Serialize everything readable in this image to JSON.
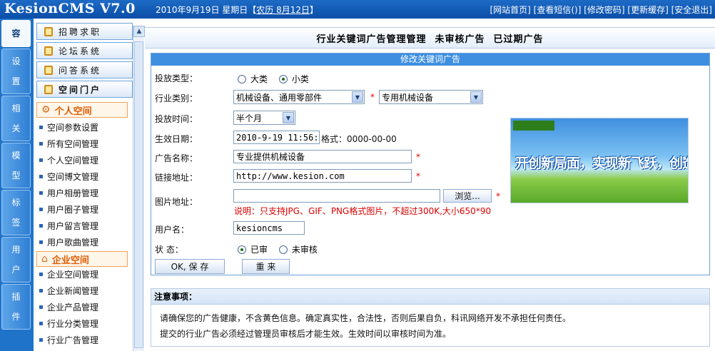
{
  "app": {
    "logo": "KesionCMS V7.0"
  },
  "header": {
    "date": "2010年9月19日 星期日【",
    "lunar": "农历 8月12日",
    "date_end": "】",
    "links": [
      {
        "label": "[网站首页]"
      },
      {
        "label": "[查看短信(",
        "badge": "",
        "after": ")]"
      },
      {
        "label": "[修改密码]"
      },
      {
        "label": "[更新缓存]"
      },
      {
        "label": "[安全退出]"
      }
    ]
  },
  "vtabs": [
    {
      "label": "容",
      "active": true
    },
    {
      "label": "设置"
    },
    {
      "label": "相关"
    },
    {
      "label": "模型"
    },
    {
      "label": "标签"
    },
    {
      "label": "用户"
    },
    {
      "label": "插件"
    }
  ],
  "sidebar": {
    "categories": [
      {
        "label": "招聘求职"
      },
      {
        "label": "论坛系统"
      },
      {
        "label": "问答系统"
      },
      {
        "label": "空间门户",
        "bold": true
      }
    ],
    "personal": {
      "title": "个人空间",
      "items": [
        "空间参数设置",
        "所有空间管理",
        "个人空间管理",
        "空间博文管理",
        "用户相册管理",
        "用户圈子管理",
        "用户留言管理",
        "用户歌曲管理"
      ]
    },
    "enterprise": {
      "title": "企业空间",
      "items": [
        "企业空间管理",
        "企业新闻管理",
        "企业产品管理",
        "行业分类管理",
        "行业广告管理"
      ]
    }
  },
  "subnav": [
    "行业关键词广告管理管理",
    "未审核广告",
    "已过期广告"
  ],
  "form": {
    "title": "修改关键词广告",
    "type_label": "投放类型：",
    "type_options": [
      {
        "label": "大类",
        "checked": false
      },
      {
        "label": "小类",
        "checked": true
      }
    ],
    "industry_label": "行业类别：",
    "industry_main": "机械设备、通用零部件",
    "industry_sub": "专用机械设备",
    "duration_label": "投放时间：",
    "duration_value": "半个月",
    "effective_label": "生效日期：",
    "effective_value": "2010-9-19 11:56:0",
    "format_hint": "格式：0000-00-00",
    "adname_label": "广告名称：",
    "adname_value": "专业提供机械设备",
    "link_label": "链接地址：",
    "link_value": "http://www.kesion.com",
    "image_label": "图片地址：",
    "image_value": "",
    "browse_label": "浏览...",
    "image_note": "说明：只支持JPG、GIF、PNG格式图片，不超过300K,大小650*90",
    "username_label": "用户名：",
    "username_value": "kesioncms",
    "status_label": "状 态：",
    "status_options": [
      {
        "label": "已审",
        "checked": true
      },
      {
        "label": "未审核",
        "checked": false
      }
    ],
    "ok_label": "OK, 保 存",
    "reset_label": "重 来",
    "required_mark": "*"
  },
  "banner": {
    "logo": "",
    "slogan": "开创新局面，实现新飞跃，创造新辉煌"
  },
  "notes": {
    "title": "注意事项：",
    "lines": [
      "请确保您的广告健康，不含黄色信息。确定真实性，合法性，否则后果自负，科讯网络开发不承担任何责任。",
      "提交的行业广告必须经过管理员审核后才能生效。生效时间以审核时间为准。"
    ]
  }
}
